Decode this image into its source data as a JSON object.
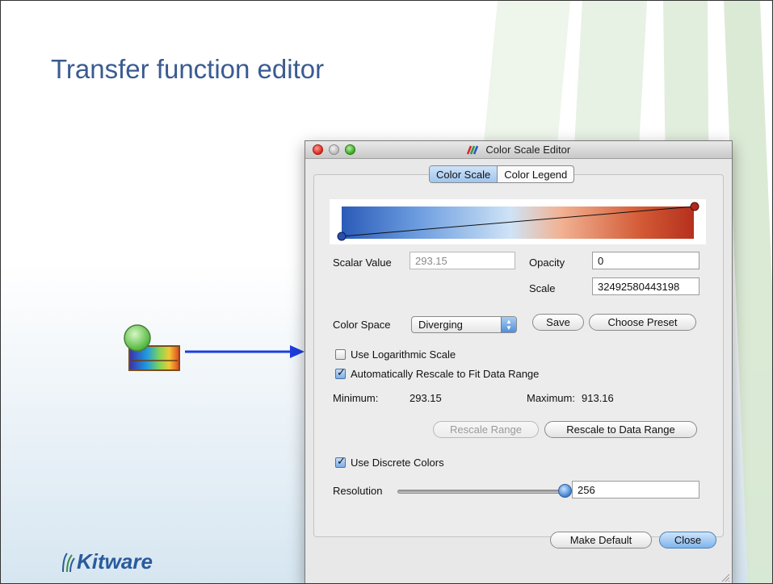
{
  "slide": {
    "title": "Transfer function editor",
    "logo_text": "Kitware"
  },
  "window": {
    "title": "Color Scale Editor",
    "title_icon": "color-scale-icon"
  },
  "tabs": [
    {
      "label": "Color Scale",
      "active": true
    },
    {
      "label": "Color Legend",
      "active": false
    }
  ],
  "transfer_function": {
    "gradient_colors": [
      "#2a5bb8",
      "#6e9ee0",
      "#cfe3f6",
      "#f1b394",
      "#d35a35",
      "#b5301e"
    ]
  },
  "scalar": {
    "label": "Scalar Value",
    "value": "293.15"
  },
  "opacity": {
    "label": "Opacity",
    "value": "0"
  },
  "scale": {
    "label": "Scale",
    "value": "32492580443198"
  },
  "color_space": {
    "label": "Color Space",
    "selected": "Diverging"
  },
  "buttons": {
    "save": "Save",
    "choose_preset": "Choose Preset",
    "rescale_range": "Rescale Range",
    "rescale_to_data_range": "Rescale to Data Range",
    "make_default": "Make Default",
    "close": "Close"
  },
  "options": {
    "log_scale": {
      "label": "Use Logarithmic Scale",
      "checked": false
    },
    "auto_rescale": {
      "label": "Automatically Rescale to Fit Data Range",
      "checked": true
    },
    "discrete_colors": {
      "label": "Use Discrete Colors",
      "checked": true
    }
  },
  "range": {
    "min_label": "Minimum:",
    "min_value": "293.15",
    "max_label": "Maximum:",
    "max_value": "913.16"
  },
  "resolution": {
    "label": "Resolution",
    "value": "256",
    "level_fraction": 1.0
  }
}
